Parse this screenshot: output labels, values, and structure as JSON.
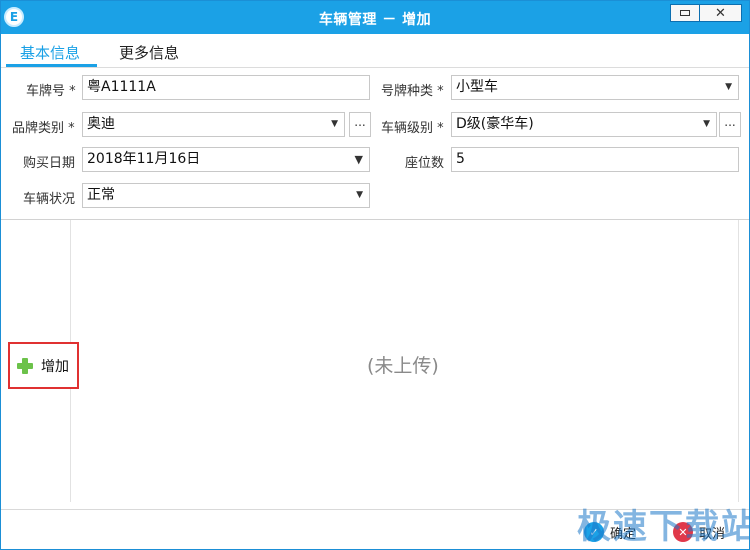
{
  "window": {
    "title": "车辆管理 － 增加",
    "app_icon_glyph": "E",
    "minimize_icon": "minimize-icon",
    "close_label": "✕"
  },
  "tabs": [
    {
      "label": "基本信息",
      "active": true
    },
    {
      "label": "更多信息",
      "active": false
    }
  ],
  "form": {
    "plate_number": {
      "label": "车牌号 *",
      "value": "粤A1111A"
    },
    "plate_type": {
      "label": "号牌种类 *",
      "value": "小型车"
    },
    "brand": {
      "label": "品牌类别 *",
      "value": "奥迪",
      "more": "..."
    },
    "vehicle_level": {
      "label": "车辆级别 *",
      "value": "D级(豪华车)",
      "more": "..."
    },
    "purchase_date": {
      "label": "购买日期",
      "value": "2018年11月16日"
    },
    "seats": {
      "label": "座位数",
      "value": "5"
    },
    "vehicle_status": {
      "label": "车辆状况",
      "value": "正常"
    }
  },
  "attachments": {
    "add_label": "增加",
    "add_icon": "plus-icon",
    "status_text": "(未上传)"
  },
  "footer": {
    "ok_label": "确定",
    "cancel_label": "取消"
  },
  "watermark": "极速下载站",
  "colors": {
    "accent": "#1ba1e6",
    "highlight_border": "#e03131",
    "plus_green": "#6cc24a"
  }
}
